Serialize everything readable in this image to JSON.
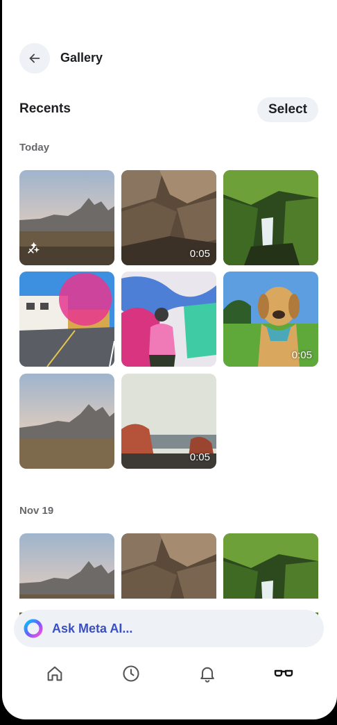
{
  "header": {
    "title": "Gallery",
    "back_icon": "arrow-left-icon"
  },
  "recents": {
    "title": "Recents",
    "select_label": "Select"
  },
  "groups": [
    {
      "label": "Today",
      "items": [
        {
          "scene": "mountain",
          "badge_icon": "magic-wand-icon",
          "duration": ""
        },
        {
          "scene": "rock",
          "duration": "0:05"
        },
        {
          "scene": "waterfall",
          "duration": ""
        },
        {
          "scene": "street",
          "duration": ""
        },
        {
          "scene": "mural",
          "duration": ""
        },
        {
          "scene": "dog",
          "duration": "0:05"
        },
        {
          "scene": "mountain",
          "duration": ""
        },
        {
          "scene": "beach",
          "duration": "0:05"
        }
      ]
    },
    {
      "label": "Nov 19",
      "items": [
        {
          "scene": "mountain",
          "duration": ""
        },
        {
          "scene": "rock",
          "duration": ""
        },
        {
          "scene": "waterfall",
          "duration": ""
        }
      ]
    }
  ],
  "ask": {
    "placeholder": "Ask Meta AI...",
    "icon": "meta-ai-ring-icon"
  },
  "nav": [
    {
      "icon": "home-icon"
    },
    {
      "icon": "clock-icon"
    },
    {
      "icon": "bell-icon"
    },
    {
      "icon": "glasses-icon"
    }
  ],
  "colors": {
    "accent": "#3b4fc5",
    "chip_bg": "#eef1f5"
  }
}
